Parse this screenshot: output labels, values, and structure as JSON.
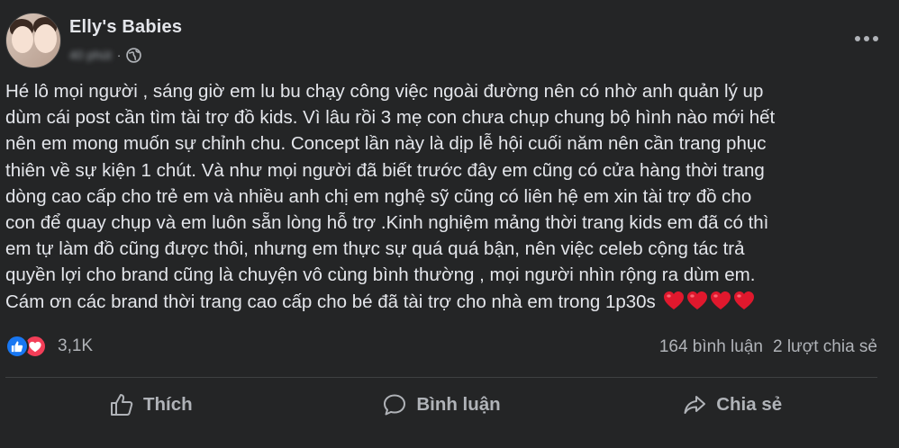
{
  "post": {
    "page_name": "Elly's Babies",
    "timestamp": "40 phút",
    "separator": "·",
    "privacy_icon": "globe-icon",
    "lines": [
      "Hé lô mọi người , sáng giờ em lu bu chạy công việc ngoài đường nên có nhờ anh quản lý up",
      "dùm cái post cần tìm tài trợ đồ kids. Vì lâu rồi 3 mẹ con chưa chụp chung bộ hình nào mới hết",
      "nên em mong muốn sự chỉnh chu. Concept lần này là dịp lễ hội cuối năm nên cần trang phục",
      "thiên về sự kiện 1 chút. Và như mọi người đã biết trước đây em cũng có cửa hàng thời trang",
      "dòng cao cấp cho trẻ em và nhiều anh chị em nghệ sỹ cũng có liên hệ em xin tài trợ đồ cho",
      "con để quay chụp và em luôn sẵn lòng hỗ trợ .Kinh nghiệm mảng thời trang kids em đã có thì",
      "em tự làm đồ cũng được thôi, nhưng em thực sự quá quá bận, nên việc celeb cộng tác trả",
      "quyền lợi cho brand cũng là chuyện vô cùng bình thường , mọi người nhìn rộng ra dùm em.",
      "Cám ơn các brand thời trang cao cấp cho bé đã tài trợ cho nhà em trong 1p30s"
    ],
    "heart_count": 4
  },
  "stats": {
    "reaction_icons": [
      "like-icon",
      "love-icon"
    ],
    "reaction_count": "3,1K",
    "comments": "164 bình luận",
    "shares": "2 lượt chia sẻ"
  },
  "actions": {
    "like_label": "Thích",
    "comment_label": "Bình luận",
    "share_label": "Chia sẻ"
  },
  "colors": {
    "background": "#242526",
    "text": "#e4e6eb",
    "secondary_text": "#b0b3b8",
    "like_blue": "#1877f2",
    "love_red": "#f33e58"
  }
}
